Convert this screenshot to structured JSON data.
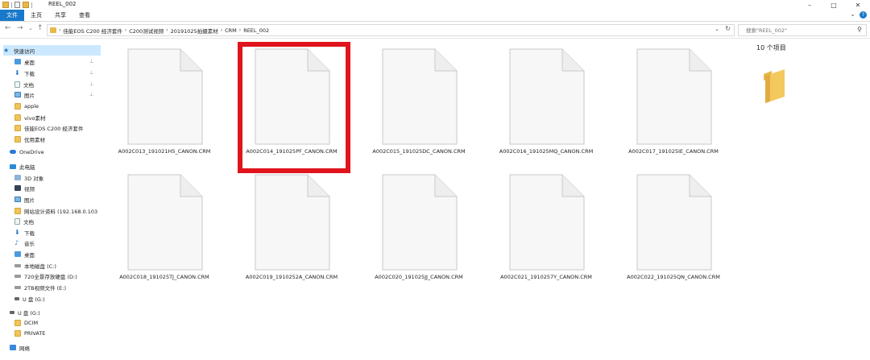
{
  "window": {
    "title": "REEL_002",
    "minimize_glyph": "–",
    "maximize_glyph": "□",
    "close_glyph": "✕"
  },
  "ribbon": {
    "tabs": [
      {
        "label": "文件",
        "active": true
      },
      {
        "label": "主页",
        "active": false
      },
      {
        "label": "共享",
        "active": false
      },
      {
        "label": "查看",
        "active": false
      }
    ],
    "help": "?",
    "expand": "⌄"
  },
  "nav": {
    "back": "←",
    "forward": "→",
    "recent": "⌄",
    "up": "↑"
  },
  "address": {
    "crumbs": [
      "佳能EOS C200 经济套件",
      "C200测试视频",
      "20191025拍摄素材",
      "CRM",
      "REEL_002"
    ],
    "separator": "›",
    "dropdown": "⌄",
    "refresh": "↻"
  },
  "search": {
    "placeholder": "搜索\"REEL_002\"",
    "icon": "search-icon"
  },
  "sidebar": {
    "items": [
      {
        "label": "快速访问",
        "icon": "star-icon",
        "pinned": false
      },
      {
        "label": "桌面",
        "icon": "desktop-icon",
        "pinned": true
      },
      {
        "label": "下载",
        "icon": "download-icon",
        "pinned": true
      },
      {
        "label": "文档",
        "icon": "document-icon",
        "pinned": true
      },
      {
        "label": "图片",
        "icon": "picture-icon",
        "pinned": true
      },
      {
        "label": "apple",
        "icon": "folder-icon",
        "pinned": false
      },
      {
        "label": "vivo素材",
        "icon": "folder-icon",
        "pinned": false
      },
      {
        "label": "佳能EOS C200 经济套件",
        "icon": "folder-icon",
        "pinned": false
      },
      {
        "label": "优用素材",
        "icon": "folder-icon",
        "pinned": false
      },
      {
        "label": "OneDrive",
        "icon": "cloud-icon",
        "pinned": false
      },
      {
        "label": "此电脑",
        "icon": "computer-icon",
        "pinned": false
      },
      {
        "label": "3D 对象",
        "icon": "cube-icon",
        "pinned": false
      },
      {
        "label": "视频",
        "icon": "video-icon",
        "pinned": false
      },
      {
        "label": "图片",
        "icon": "picture-icon",
        "pinned": false
      },
      {
        "label": "网站设计资料 (192.168.0.103",
        "icon": "folder-icon",
        "pinned": false
      },
      {
        "label": "文档",
        "icon": "document-icon",
        "pinned": false
      },
      {
        "label": "下载",
        "icon": "download-icon",
        "pinned": false
      },
      {
        "label": "音乐",
        "icon": "music-icon",
        "pinned": false
      },
      {
        "label": "桌面",
        "icon": "desktop-icon",
        "pinned": false
      },
      {
        "label": "本地磁盘 (C:)",
        "icon": "drive-icon",
        "pinned": false
      },
      {
        "label": "720全景存放硬盘 (D:)",
        "icon": "drive-icon",
        "pinned": false
      },
      {
        "label": "2TB视频文件 (E:)",
        "icon": "drive-icon",
        "pinned": false
      },
      {
        "label": "U 盘 (G:)",
        "icon": "usb-icon",
        "pinned": false
      },
      {
        "label": "U 盘 (G:)",
        "icon": "usb-icon",
        "pinned": false
      },
      {
        "label": "DCIM",
        "icon": "folder-icon",
        "pinned": false
      },
      {
        "label": "PRIVATE",
        "icon": "folder-icon",
        "pinned": false
      },
      {
        "label": "网络",
        "icon": "network-icon",
        "pinned": false
      }
    ],
    "pin_glyph": "📌"
  },
  "files": [
    {
      "name": "A002C013_191021H5_CANON.CRM",
      "highlighted": false
    },
    {
      "name": "A002C014_191025PF_CANON.CRM",
      "highlighted": true
    },
    {
      "name": "A002C015_191025DC_CANON.CRM",
      "highlighted": false
    },
    {
      "name": "A002C016_191025MQ_CANON.CRM",
      "highlighted": false
    },
    {
      "name": "A002C017_191025IE_CANON.CRM",
      "highlighted": false
    },
    {
      "name": "A002C018_191025TJ_CANON.CRM",
      "highlighted": false
    },
    {
      "name": "A002C019_1910252A_CANON.CRM",
      "highlighted": false
    },
    {
      "name": "A002C020_191025JJ_CANON.CRM",
      "highlighted": false
    },
    {
      "name": "A002C021_1910257Y_CANON.CRM",
      "highlighted": false
    },
    {
      "name": "A002C022_191025QN_CANON.CRM",
      "highlighted": false
    }
  ],
  "preview": {
    "count_text": "10 个项目"
  },
  "colors": {
    "accent": "#1979ca",
    "highlight_box": "#e0141c",
    "selection": "#cce8ff",
    "folder": "#f0c458"
  }
}
